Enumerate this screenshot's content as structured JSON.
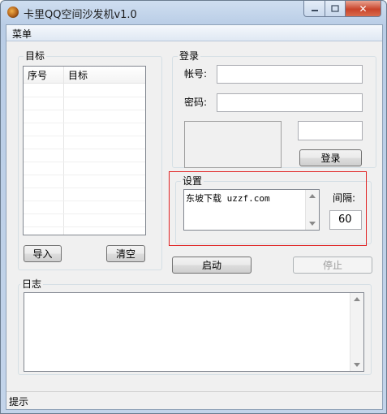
{
  "window": {
    "title": "卡里QQ空间沙发机v1.0",
    "app_icon": "app-logo-icon"
  },
  "caption_buttons": {
    "minimize": "—",
    "maximize": "□",
    "close": "✕"
  },
  "menu": {
    "label": "菜单"
  },
  "target_group": {
    "label": "目标",
    "columns": [
      "序号",
      "目标"
    ],
    "import_button": "导入",
    "clear_button": "清空"
  },
  "login_group": {
    "label": "登录",
    "account_label": "帐号:",
    "account_value": "",
    "password_label": "密码:",
    "password_value": "",
    "captcha_value": "",
    "login_button": "登录"
  },
  "settings_group": {
    "label": "设置",
    "text_value": "东坡下载 uzzf.com",
    "interval_label": "间隔:",
    "interval_value": "60",
    "highlight_color": "#e02020"
  },
  "actions": {
    "start_button": "启动",
    "stop_button": "停止"
  },
  "log_group": {
    "label": "日志",
    "content": ""
  },
  "status_bar": {
    "text": "提示"
  }
}
